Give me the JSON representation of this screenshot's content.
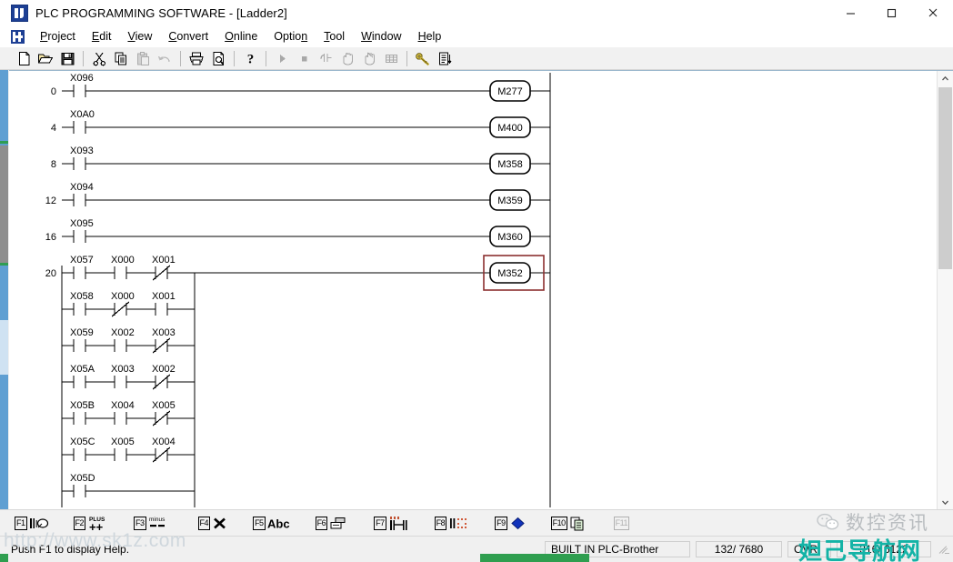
{
  "window": {
    "title": "PLC PROGRAMMING SOFTWARE - [Ladder2]",
    "app_icon": "plc-app-icon",
    "controls": {
      "minimize": "minimize-icon",
      "maximize": "maximize-icon",
      "close": "close-icon"
    },
    "mdi_controls": {
      "minimize": "mdi-minimize-icon",
      "restore": "mdi-restore-icon",
      "close": "mdi-close-icon"
    }
  },
  "menu": {
    "items": [
      {
        "label": "Project",
        "accel": "P"
      },
      {
        "label": "Edit",
        "accel": "E"
      },
      {
        "label": "View",
        "accel": "V"
      },
      {
        "label": "Convert",
        "accel": "C"
      },
      {
        "label": "Online",
        "accel": "O"
      },
      {
        "label": "Option",
        "accel": "n"
      },
      {
        "label": "Tool",
        "accel": "T"
      },
      {
        "label": "Window",
        "accel": "W"
      },
      {
        "label": "Help",
        "accel": "H"
      }
    ]
  },
  "toolbar": {
    "buttons": [
      {
        "name": "new-file-icon",
        "enabled": true
      },
      {
        "name": "open-folder-icon",
        "enabled": true
      },
      {
        "name": "save-disk-icon",
        "enabled": true
      },
      {
        "name": "separator",
        "enabled": true
      },
      {
        "name": "cut-scissors-icon",
        "enabled": true
      },
      {
        "name": "copy-icon",
        "enabled": true
      },
      {
        "name": "paste-icon",
        "enabled": false
      },
      {
        "name": "undo-icon",
        "enabled": false
      },
      {
        "name": "separator",
        "enabled": true
      },
      {
        "name": "print-icon",
        "enabled": true
      },
      {
        "name": "print-preview-icon",
        "enabled": true
      },
      {
        "name": "separator",
        "enabled": true
      },
      {
        "name": "help-question-icon",
        "enabled": true
      },
      {
        "name": "separator",
        "enabled": true
      },
      {
        "name": "run-play-icon",
        "enabled": false
      },
      {
        "name": "stop-square-icon",
        "enabled": false
      },
      {
        "name": "contact-monitor-icon",
        "enabled": false
      },
      {
        "name": "hand-icon",
        "enabled": false
      },
      {
        "name": "hand-write-icon",
        "enabled": false
      },
      {
        "name": "grid-table-icon",
        "enabled": false
      },
      {
        "name": "separator",
        "enabled": true
      },
      {
        "name": "key-icon",
        "enabled": true
      },
      {
        "name": "list-sort-icon",
        "enabled": true
      }
    ]
  },
  "ladder": {
    "rungs": [
      {
        "step": "0",
        "contacts": [
          {
            "label": "X096",
            "type": "NO"
          }
        ],
        "coil": "M277",
        "selected": false
      },
      {
        "step": "4",
        "contacts": [
          {
            "label": "X0A0",
            "type": "NO"
          }
        ],
        "coil": "M400",
        "selected": false
      },
      {
        "step": "8",
        "contacts": [
          {
            "label": "X093",
            "type": "NO"
          }
        ],
        "coil": "M358",
        "selected": false
      },
      {
        "step": "12",
        "contacts": [
          {
            "label": "X094",
            "type": "NO"
          }
        ],
        "coil": "M359",
        "selected": false
      },
      {
        "step": "16",
        "contacts": [
          {
            "label": "X095",
            "type": "NO"
          }
        ],
        "coil": "M360",
        "selected": false
      },
      {
        "step": "20",
        "coil": "M352",
        "selected": true,
        "branches": [
          {
            "contacts": [
              {
                "label": "X057",
                "type": "NO"
              },
              {
                "label": "X000",
                "type": "NO"
              },
              {
                "label": "X001",
                "type": "NC"
              }
            ]
          },
          {
            "contacts": [
              {
                "label": "X058",
                "type": "NO"
              },
              {
                "label": "X000",
                "type": "NC"
              },
              {
                "label": "X001",
                "type": "NO"
              }
            ]
          },
          {
            "contacts": [
              {
                "label": "X059",
                "type": "NO"
              },
              {
                "label": "X002",
                "type": "NO"
              },
              {
                "label": "X003",
                "type": "NC"
              }
            ]
          },
          {
            "contacts": [
              {
                "label": "X05A",
                "type": "NO"
              },
              {
                "label": "X003",
                "type": "NO"
              },
              {
                "label": "X002",
                "type": "NC"
              }
            ]
          },
          {
            "contacts": [
              {
                "label": "X05B",
                "type": "NO"
              },
              {
                "label": "X004",
                "type": "NO"
              },
              {
                "label": "X005",
                "type": "NC"
              }
            ]
          },
          {
            "contacts": [
              {
                "label": "X05C",
                "type": "NO"
              },
              {
                "label": "X005",
                "type": "NO"
              },
              {
                "label": "X004",
                "type": "NC"
              }
            ]
          },
          {
            "contacts": [
              {
                "label": "X05D",
                "type": "NO"
              }
            ]
          }
        ]
      }
    ],
    "selection_color": "#8c3030"
  },
  "scrollbar": {
    "up_arrow": "chevron-up-icon",
    "down_arrow": "chevron-down-icon"
  },
  "function_keys": [
    {
      "key": "F1",
      "glyph": "coil-write-icon",
      "label": "",
      "enabled": true
    },
    {
      "key": "F2",
      "glyph": "plus-plus-icon",
      "label": "PLUS",
      "enabled": true
    },
    {
      "key": "F3",
      "glyph": "minus-minus-icon",
      "label": "minus",
      "enabled": true
    },
    {
      "key": "F4",
      "glyph": "delete-x-icon",
      "label": "",
      "enabled": true
    },
    {
      "key": "F5",
      "glyph": "abc-text-icon",
      "label": "Abc",
      "enabled": true
    },
    {
      "key": "F6",
      "glyph": "block-copy-icon",
      "label": "",
      "enabled": true
    },
    {
      "key": "F7",
      "glyph": "branch-insert-icon",
      "label": "",
      "enabled": true
    },
    {
      "key": "F8",
      "glyph": "select-region-icon",
      "label": "",
      "enabled": true
    },
    {
      "key": "F9",
      "glyph": "blue-diamond-icon",
      "label": "",
      "enabled": true
    },
    {
      "key": "F10",
      "glyph": "duplicate-icon",
      "label": "",
      "enabled": true
    },
    {
      "key": "F11",
      "glyph": "disabled-icon",
      "label": "",
      "enabled": false
    }
  ],
  "statusbar": {
    "help_text": "Push F1 to display Help.",
    "plc_type": "BUILT IN PLC-Brother",
    "steps": "132/ 7680",
    "mode": "OVR",
    "position": "316/ 6122"
  },
  "watermarks": {
    "url": "http://www.sk1z.com",
    "cn_gray": "数控资讯",
    "cn_teal": "妲己导航网"
  }
}
